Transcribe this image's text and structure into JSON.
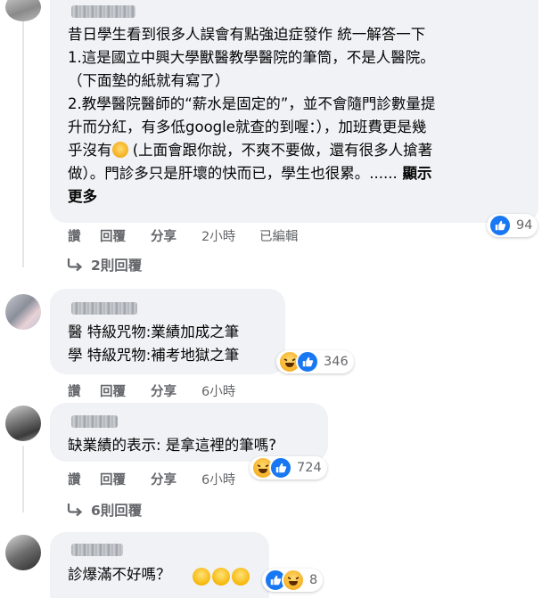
{
  "comments": [
    {
      "lines": [
        "昔日學生看到很多人誤會有點強迫症發作 統一解答一下",
        "1.這是國立中興大學獸醫教學醫院的筆筒，不是人醫院。",
        "（下面墊的紙就有寫了）",
        "2.教學醫院醫師的“薪水是固定的”，並不會隨門診數量提",
        "升而分紅，有多低google就查的到喔：），加班費更是幾",
        "乎沒有",
        " (上面會跟你說，不爽不要做，還有很多人搶著",
        "做）。門診多只是肝壞的快而已，學生也很累。......",
        " 顯示",
        "更多"
      ],
      "reaction_count": "94",
      "actions": {
        "like": "讚",
        "reply": "回覆",
        "share": "分享",
        "time": "2小時",
        "edited": "已編輯"
      },
      "replies_label": "2則回覆"
    },
    {
      "lines": [
        "醫 特級咒物:業績加成之筆",
        "學 特級咒物:補考地獄之筆"
      ],
      "reaction_count": "346",
      "actions": {
        "like": "讚",
        "reply": "回覆",
        "share": "分享",
        "time": "6小時"
      }
    },
    {
      "lines": [
        "缺業績的表示: 是拿這裡的筆嗎?"
      ],
      "reaction_count": "724",
      "actions": {
        "like": "讚",
        "reply": "回覆",
        "share": "分享",
        "time": "6小時"
      },
      "replies_label": "6則回覆"
    },
    {
      "lines": [
        "診爆滿不好嗎？"
      ],
      "reaction_count": "8"
    }
  ],
  "icons": {
    "like": "thumbs-up-icon",
    "haha": "laughing-face-icon",
    "think": "thinking-face-icon",
    "reply_arrow": "reply-arrow-icon"
  },
  "colors": {
    "like": "#1877f2",
    "bubble": "#f0f2f5",
    "meta": "#65676b"
  }
}
